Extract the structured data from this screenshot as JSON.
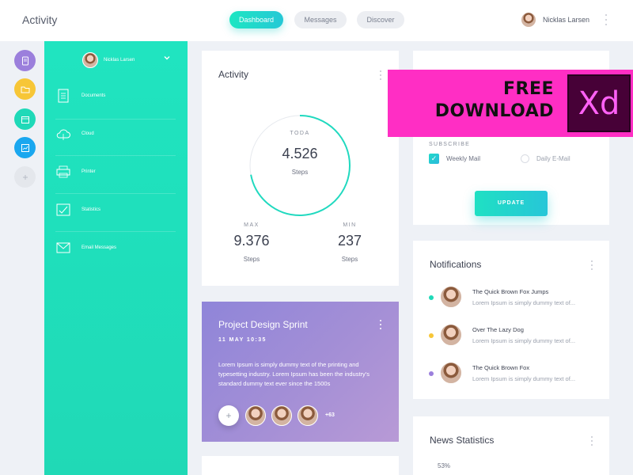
{
  "app": {
    "title": "Activity"
  },
  "nav": [
    {
      "label": "Dashboard",
      "active": true
    },
    {
      "label": "Messages",
      "active": false
    },
    {
      "label": "Discover",
      "active": false
    }
  ],
  "user": {
    "name": "Nicklas Larsen",
    "sidebar_name": "Nicklas Larsen"
  },
  "rail": [
    {
      "icon": "document-icon",
      "color": "#9b7fdc"
    },
    {
      "icon": "folder-icon",
      "color": "#f7c637"
    },
    {
      "icon": "calendar-icon",
      "color": "#1fd9b8"
    },
    {
      "icon": "chart-icon",
      "color": "#1aa7ef"
    },
    {
      "icon": "plus-icon",
      "color": "#e4e7ec"
    }
  ],
  "sidebar": {
    "items": [
      {
        "label": "Documents",
        "icon": "document-icon"
      },
      {
        "label": "Cloud",
        "icon": "cloud-icon"
      },
      {
        "label": "Printer",
        "icon": "printer-icon"
      },
      {
        "label": "Statistics",
        "icon": "statistics-icon"
      },
      {
        "label": "Email Messages",
        "icon": "email-icon"
      }
    ]
  },
  "activity": {
    "title": "Activity",
    "today_label": "TODA",
    "today_value": "4.526",
    "today_unit": "Steps",
    "ring_fraction": 0.72,
    "max_label": "MAX",
    "max_value": "9.376",
    "max_unit": "Steps",
    "min_label": "MIN",
    "min_value": "237",
    "min_unit": "Steps"
  },
  "project": {
    "title": "Project Design Sprint",
    "date": "11 MAY 10:35",
    "body": "Lorem Ipsum is simply dummy text of the printing and typesetting industry. Lorem Ipsum has been the industry's standard dummy text ever since the 1500s",
    "add": "+",
    "more": "+63"
  },
  "subscribe": {
    "label": "SUBSCRIBE",
    "option1": "Weekly Mail",
    "option2": "Daily E-Mail",
    "button": "UPDATE"
  },
  "notifications": {
    "title": "Notifications",
    "items": [
      {
        "title": "The Quick Brown Fox Jumps",
        "body": "Lorem Ipsum is simply dummy text of...",
        "dot": "#1fd9b8"
      },
      {
        "title": "Over The Lazy Dog",
        "body": "Lorem Ipsum is simply dummy text of...",
        "dot": "#f7c637"
      },
      {
        "title": "The Quick Brown Fox",
        "body": "Lorem Ipsum is simply dummy text of...",
        "dot": "#9b7fdc"
      }
    ]
  },
  "news": {
    "title": "News Statistics",
    "value": "53%"
  },
  "promo": {
    "line1": "FREE",
    "line2": "DOWNLOAD",
    "badge": "Xd"
  },
  "colors": {
    "accent": "#20e4c0",
    "purple": "#9b8ad8",
    "promo": "#ff2ec4"
  }
}
